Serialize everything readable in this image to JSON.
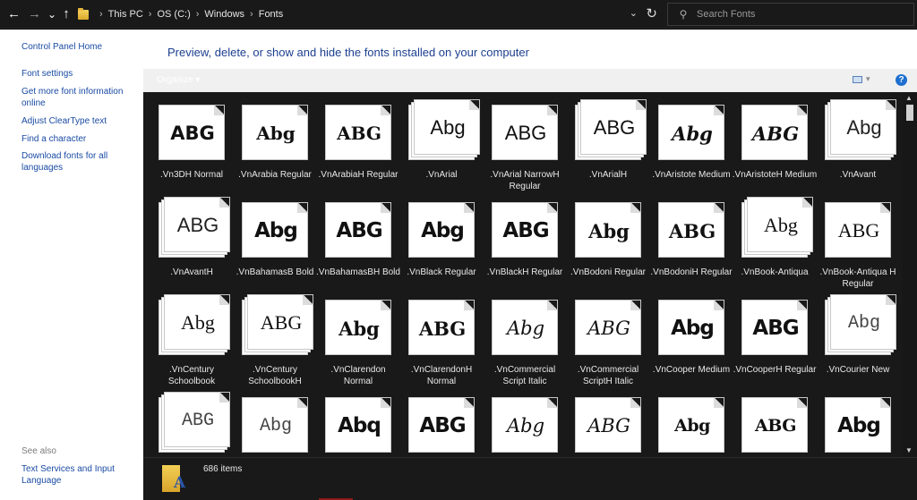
{
  "toolbar": {
    "back": "←",
    "forward": "→",
    "recent": "⌄",
    "up": "↑",
    "breadcrumb": [
      "This PC",
      "OS (C:)",
      "Windows",
      "Fonts"
    ],
    "dropdown": "⌄",
    "refresh": "↻"
  },
  "search": {
    "placeholder": "Search Fonts",
    "icon": "search-icon"
  },
  "left_pane": {
    "home": "Control Panel Home",
    "links": [
      "Font settings",
      "Get more font information online",
      "Adjust ClearType text",
      "Find a character",
      "Download fonts for all languages"
    ],
    "see_also_title": "See also",
    "see_also": [
      "Text Services and Input Language"
    ]
  },
  "main": {
    "title": "Preview, delete, or show and hide the fonts installed on your computer",
    "organize": "Organize ▾",
    "help": "?"
  },
  "fonts": [
    {
      "name": ".Vn3DH Normal",
      "sample": "ABG",
      "style": "s-sans-b",
      "stack": 1
    },
    {
      "name": ".VnArabia Regular",
      "sample": "Abg",
      "style": "s-arabia",
      "stack": 1
    },
    {
      "name": ".VnArabiaH Regular",
      "sample": "ABG",
      "style": "s-arabia",
      "stack": 1
    },
    {
      "name": ".VnArial",
      "sample": "Abg",
      "style": "s-sans",
      "stack": 3
    },
    {
      "name": ".VnArial NarrowH Regular",
      "sample": "ABG",
      "style": "s-sans",
      "stack": 1
    },
    {
      "name": ".VnArialH",
      "sample": "ABG",
      "style": "s-sans",
      "stack": 3
    },
    {
      "name": ".VnAristote Medium",
      "sample": "Abg",
      "style": "s-script-b",
      "stack": 1
    },
    {
      "name": ".VnAristoteH Medium",
      "sample": "ABG",
      "style": "s-script-b",
      "stack": 1
    },
    {
      "name": ".VnAvant",
      "sample": "Abg",
      "style": "s-light",
      "stack": 3
    },
    {
      "name": ".VnAvantH",
      "sample": "ABG",
      "style": "s-light",
      "stack": 3
    },
    {
      "name": ".VnBahamasB Bold",
      "sample": "Abg",
      "style": "s-black",
      "stack": 1
    },
    {
      "name": ".VnBahamasBH Bold",
      "sample": "ABG",
      "style": "s-black",
      "stack": 1
    },
    {
      "name": ".VnBlack Regular",
      "sample": "Abg",
      "style": "s-black",
      "stack": 1
    },
    {
      "name": ".VnBlackH Regular",
      "sample": "ABG",
      "style": "s-black",
      "stack": 1
    },
    {
      "name": ".VnBodoni Regular",
      "sample": "Abg",
      "style": "s-serif-b",
      "stack": 1
    },
    {
      "name": ".VnBodoniH Regular",
      "sample": "ABG",
      "style": "s-serif-b",
      "stack": 1
    },
    {
      "name": ".VnBook-Antiqua",
      "sample": "Abg",
      "style": "s-serif",
      "stack": 3
    },
    {
      "name": ".VnBook-Antiqua H Regular",
      "sample": "ABG",
      "style": "s-serif",
      "stack": 1
    },
    {
      "name": ".VnCentury Schoolbook",
      "sample": "Abg",
      "style": "s-serif",
      "stack": 3
    },
    {
      "name": ".VnCentury SchoolbookH",
      "sample": "ABG",
      "style": "s-serif",
      "stack": 3
    },
    {
      "name": ".VnClarendon Normal",
      "sample": "Abg",
      "style": "s-serif-b",
      "stack": 1
    },
    {
      "name": ".VnClarendonH Normal",
      "sample": "ABG",
      "style": "s-serif-b",
      "stack": 1
    },
    {
      "name": ".VnCommercial Script Italic",
      "sample": "Abg",
      "style": "s-script",
      "stack": 1
    },
    {
      "name": ".VnCommercial ScriptH Italic",
      "sample": "ABG",
      "style": "s-script",
      "stack": 1
    },
    {
      "name": ".VnCooper Medium",
      "sample": "Abg",
      "style": "s-black",
      "stack": 1
    },
    {
      "name": ".VnCooperH Regular",
      "sample": "ABG",
      "style": "s-black",
      "stack": 1
    },
    {
      "name": ".VnCourier New",
      "sample": "Abg",
      "style": "s-mono",
      "stack": 3
    },
    {
      "name": "",
      "sample": "ABG",
      "style": "s-mono",
      "stack": 3
    },
    {
      "name": "",
      "sample": "Abg",
      "style": "s-mono",
      "stack": 1
    },
    {
      "name": "",
      "sample": "Abq",
      "style": "s-black",
      "stack": 1
    },
    {
      "name": "",
      "sample": "ABG",
      "style": "s-black",
      "stack": 1
    },
    {
      "name": "",
      "sample": "Abg",
      "style": "s-script",
      "stack": 1
    },
    {
      "name": "",
      "sample": "ABG",
      "style": "s-script",
      "stack": 1
    },
    {
      "name": "",
      "sample": "Abg",
      "style": "s-goth",
      "stack": 1
    },
    {
      "name": "",
      "sample": "ABG",
      "style": "s-goth",
      "stack": 1
    },
    {
      "name": "",
      "sample": "Abg",
      "style": "s-black",
      "stack": 1
    }
  ],
  "status": {
    "count": "686 items"
  },
  "colors": {
    "link": "#1a4ba3",
    "title": "#1c3f8f",
    "dark": "#191919"
  }
}
